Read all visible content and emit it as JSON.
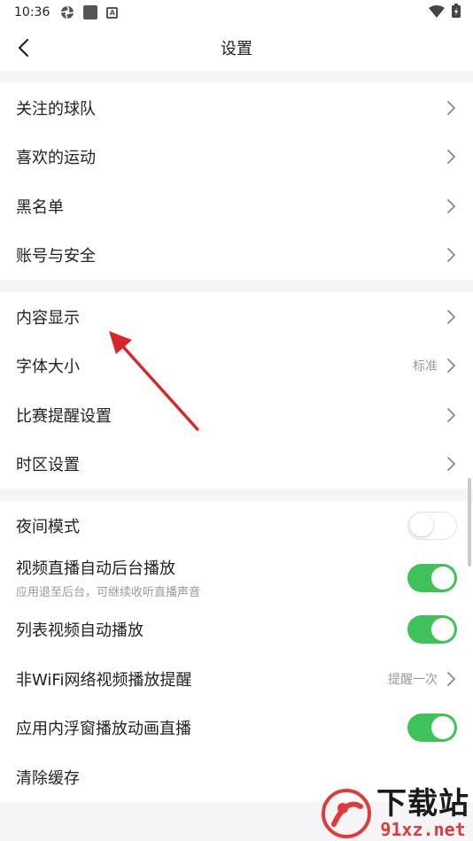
{
  "status_bar": {
    "time": "10:36"
  },
  "nav": {
    "title": "设置"
  },
  "group1": [
    {
      "label": "关注的球队"
    },
    {
      "label": "喜欢的运动"
    },
    {
      "label": "黑名单"
    },
    {
      "label": "账号与安全"
    }
  ],
  "group2": [
    {
      "label": "内容显示"
    },
    {
      "label": "字体大小",
      "value": "标准"
    },
    {
      "label": "比赛提醒设置"
    },
    {
      "label": "时区设置"
    }
  ],
  "group3": {
    "night_mode": {
      "label": "夜间模式",
      "on": false
    },
    "bg_play": {
      "label": "视频直播自动后台播放",
      "sub": "应用退至后台，可继续收听直播声音",
      "on": true
    },
    "list_autoplay": {
      "label": "列表视频自动播放",
      "on": true
    },
    "non_wifi": {
      "label": "非WiFi网络视频播放提醒",
      "value": "提醒一次"
    },
    "float_window": {
      "label": "应用内浮窗播放动画直播",
      "on": true
    },
    "clear_cache": {
      "label": "清除缓存"
    }
  },
  "watermark": {
    "top": "下载站",
    "bottom": "91xz.net"
  },
  "colors": {
    "accent_green": "#3fc25a",
    "annotation_red": "#d9262b"
  }
}
